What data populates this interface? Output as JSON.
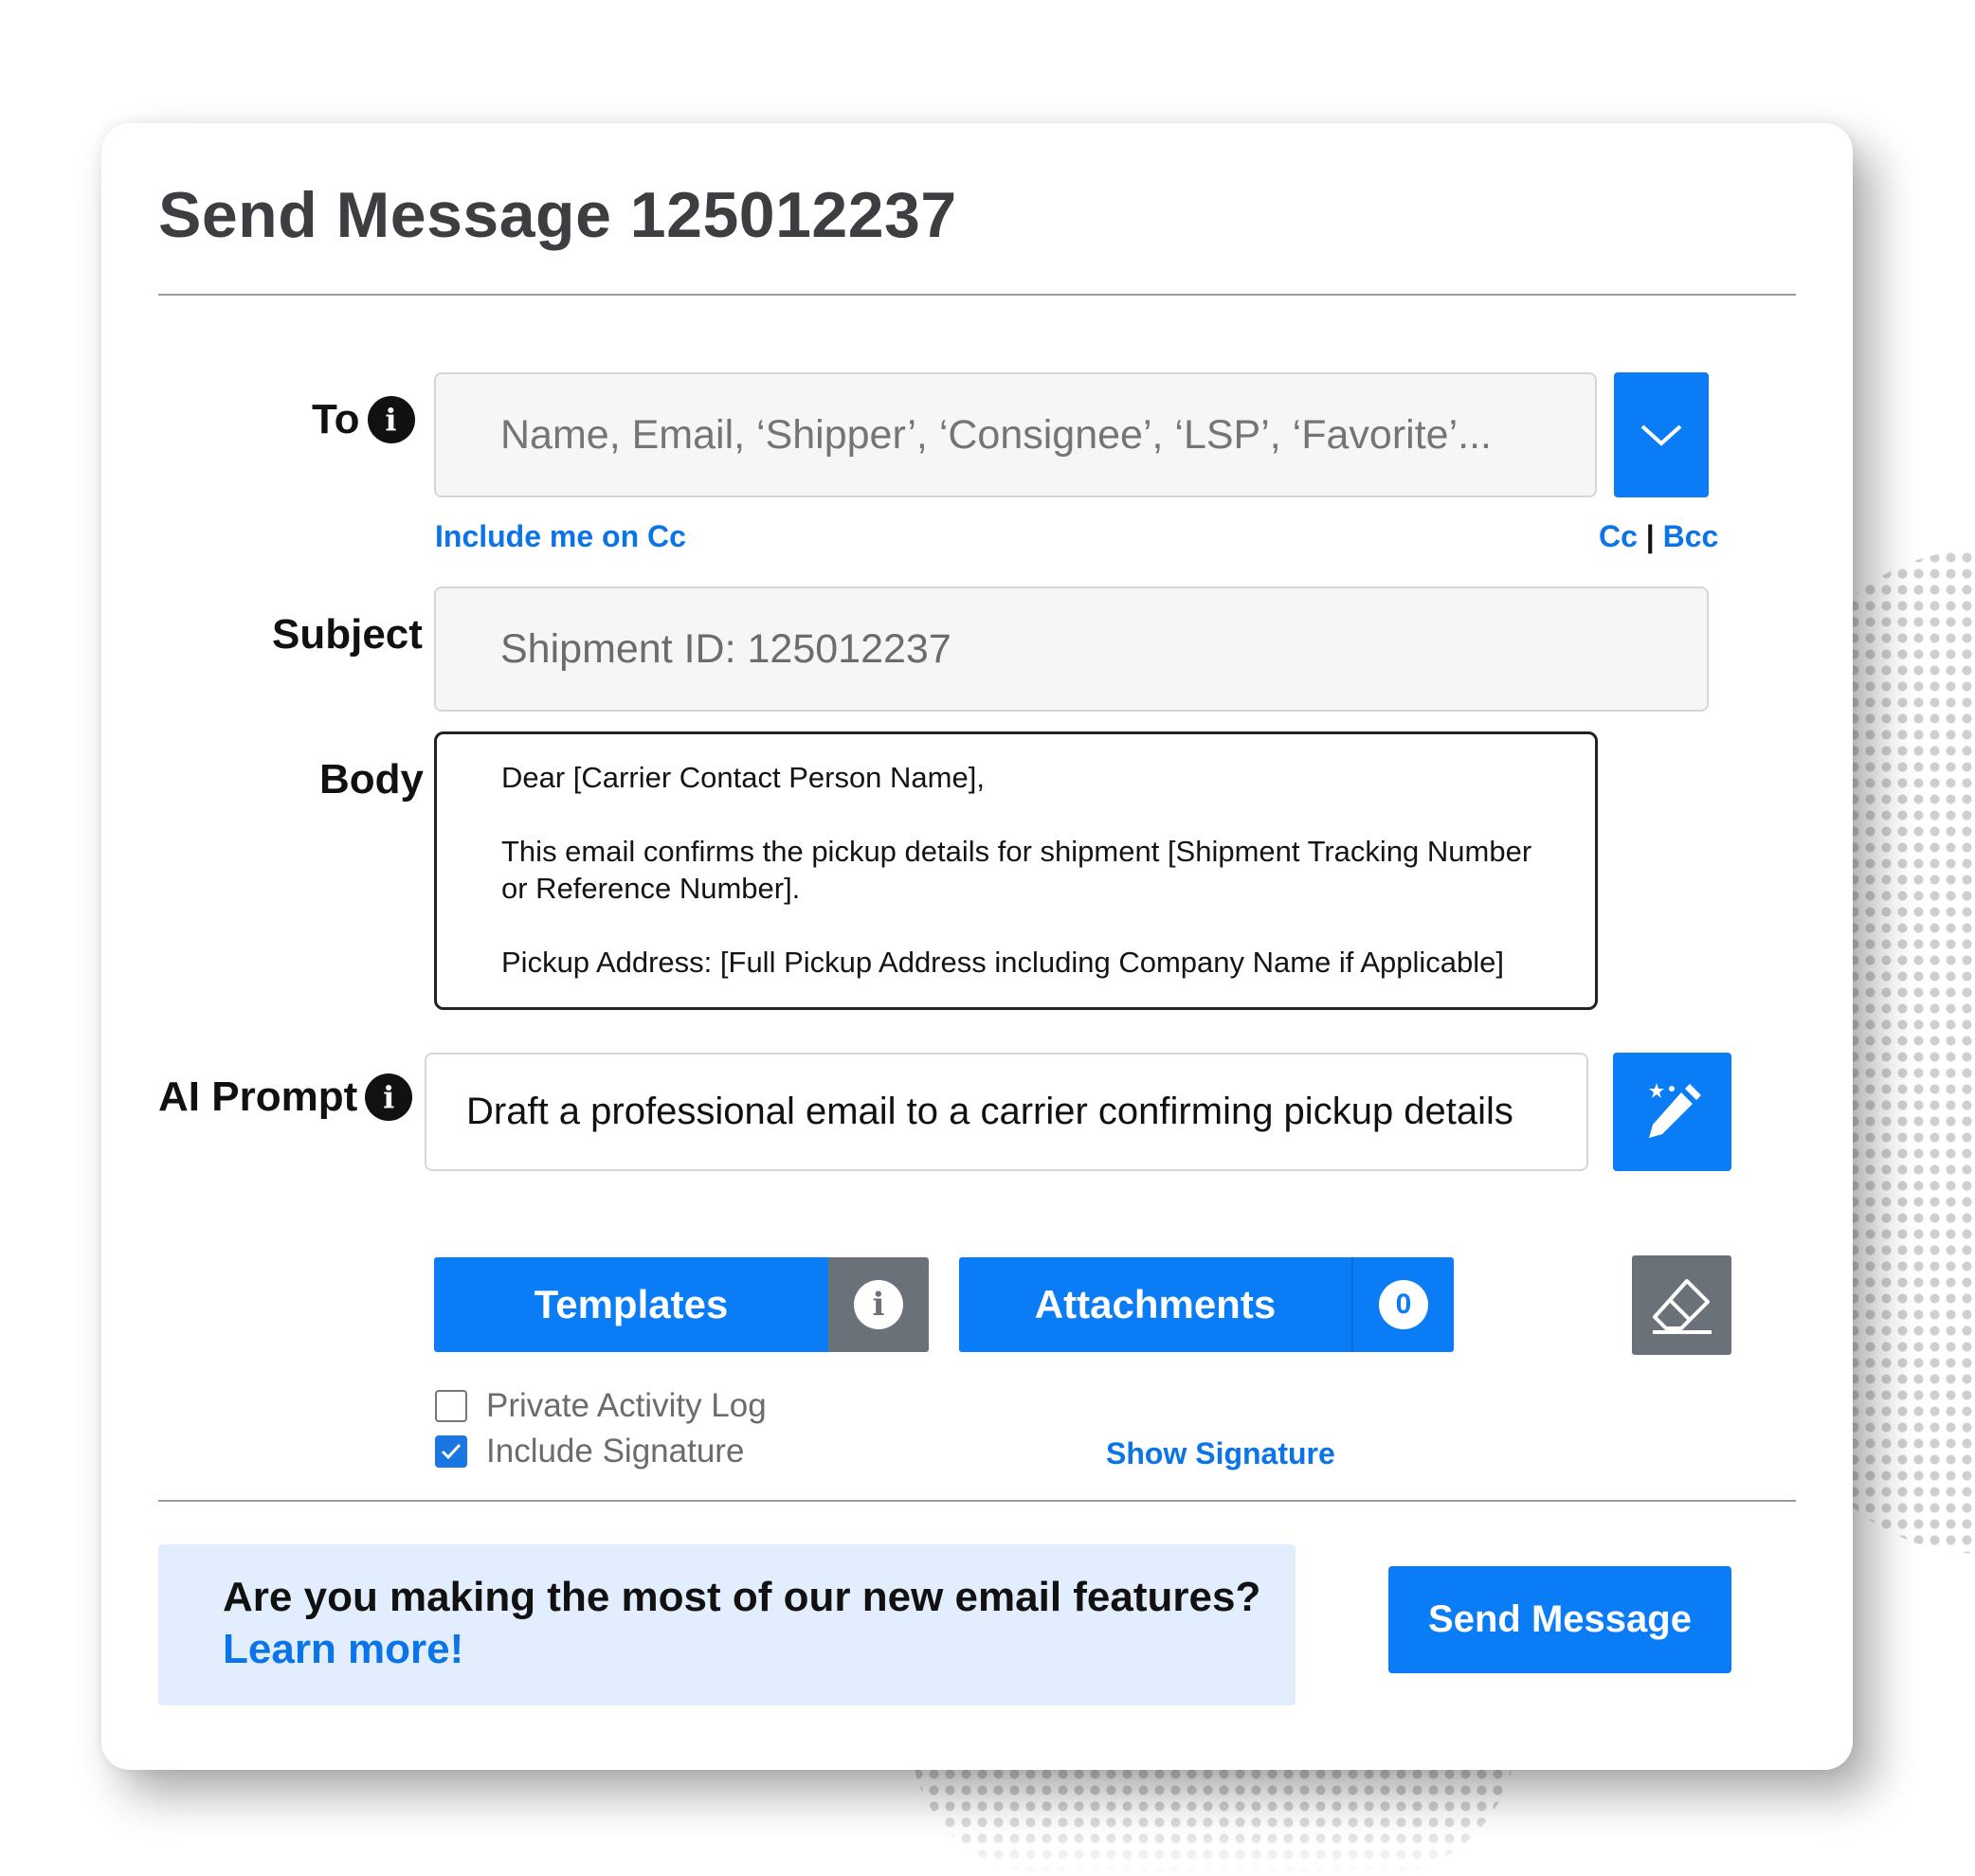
{
  "dialog": {
    "title": "Send Message 125012237"
  },
  "to": {
    "label": "To",
    "placeholder": "Name, Email, ‘Shipper’, ‘Consignee’, ‘LSP’, ‘Favorite’...",
    "include_me_cc": "Include me on Cc",
    "cc": "Cc",
    "separator": "|",
    "bcc": "Bcc"
  },
  "subject": {
    "label": "Subject",
    "value": "Shipment ID: 125012237"
  },
  "body": {
    "label": "Body",
    "lines": [
      "Dear [Carrier Contact Person Name],",
      "This email confirms the pickup details for shipment [Shipment Tracking Number or Reference Number].",
      "Pickup Address: [Full Pickup Address including Company Name if Applicable]"
    ]
  },
  "ai_prompt": {
    "label": "AI Prompt",
    "value": "Draft a professional email to a carrier confirming pickup details"
  },
  "buttons": {
    "templates": "Templates",
    "attachments": "Attachments",
    "attachments_count": "0",
    "send": "Send Message"
  },
  "options": {
    "private_activity_log": "Private Activity Log",
    "private_activity_log_checked": false,
    "include_signature": "Include Signature",
    "include_signature_checked": true,
    "show_signature": "Show Signature"
  },
  "promo": {
    "question": "Are you making the most of our new email features?",
    "link": "Learn more!"
  },
  "colors": {
    "accent": "#0a7cf5",
    "link": "#0a74e8",
    "gray_button": "#6b7178",
    "promo_bg": "#e2eefd"
  },
  "icons": {
    "to_info": "info-icon",
    "to_dropdown": "chevron-down-icon",
    "ai_info": "info-icon",
    "ai_generate": "magic-pencil-icon",
    "templates_info": "info-icon",
    "clear": "eraser-icon",
    "checkmark": "check-icon"
  }
}
